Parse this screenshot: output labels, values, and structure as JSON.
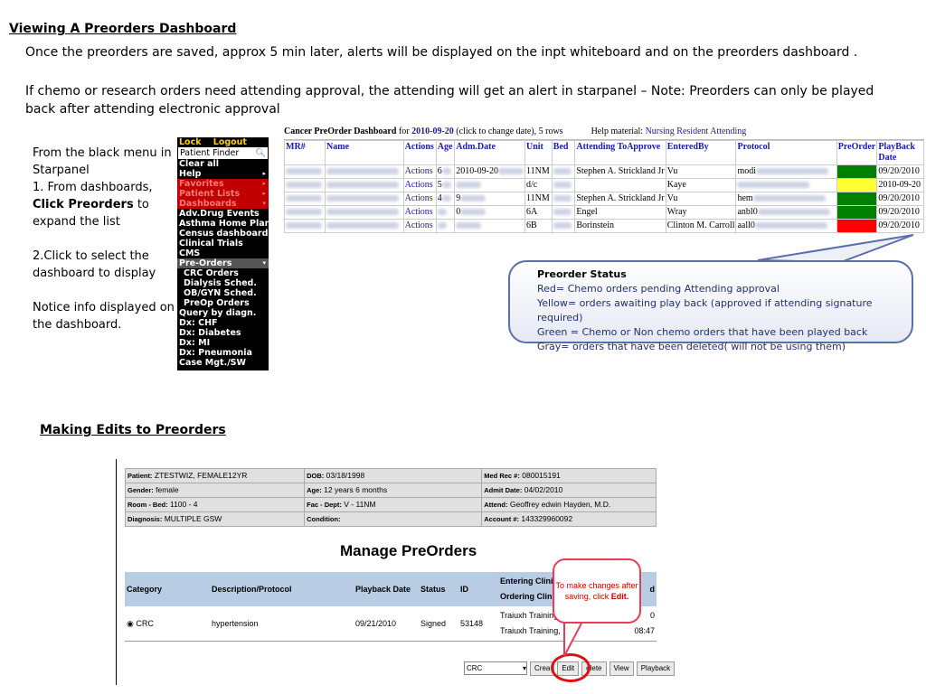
{
  "title": "Viewing  A Preorders Dashboard",
  "para1": "Once the preorders are saved, approx 5 min later, alerts will be displayed on the inpt whiteboard and on the preorders dashboard .",
  "para2": " If chemo or  research orders need attending approval,  the attending will get an alert in starpanel – Note:  Preorders can only be played back after attending electronic approval",
  "side": {
    "l1": "From the black menu in Starpanel",
    "l2a": "1. From dashboards, ",
    "l2b": "Click Preorders",
    "l2c": "  to expand the list",
    "l3": "2.Click  to select the dashboard to display",
    "l4": "Notice info displayed on the dashboard."
  },
  "menu": {
    "lock": "Lock",
    "logout": "Logout",
    "finder": "Patient Finder",
    "search_icon": "search-icon",
    "items": [
      {
        "label": "Clear all",
        "style": "plain",
        "arrow": ""
      },
      {
        "label": "Help",
        "style": "plain",
        "arrow": "▸"
      },
      {
        "label": "Favorites",
        "style": "red",
        "arrow": "▸"
      },
      {
        "label": "Patient Lists",
        "style": "red",
        "arrow": "▸"
      },
      {
        "label": "Dashboards",
        "style": "red",
        "arrow": "▾"
      },
      {
        "label": "Adv.Drug Events",
        "style": "plain",
        "arrow": ""
      },
      {
        "label": "Asthma Home Plan",
        "style": "plain",
        "arrow": ""
      },
      {
        "label": "Census dashboard",
        "style": "plain",
        "arrow": ""
      },
      {
        "label": "Clinical Trials",
        "style": "plain",
        "arrow": ""
      },
      {
        "label": "CMS",
        "style": "plain",
        "arrow": ""
      },
      {
        "label": "Pre-Orders",
        "style": "gray",
        "arrow": "▾"
      },
      {
        "label": "CRC Orders",
        "style": "sub",
        "arrow": ""
      },
      {
        "label": "Dialysis Sched.",
        "style": "sub",
        "arrow": ""
      },
      {
        "label": "OB/GYN Sched.",
        "style": "sub",
        "arrow": ""
      },
      {
        "label": "PreOp Orders",
        "style": "sub",
        "arrow": ""
      },
      {
        "label": "Query by diagn.",
        "style": "plain",
        "arrow": ""
      },
      {
        "label": "Dx: CHF",
        "style": "plain",
        "arrow": ""
      },
      {
        "label": "Dx: Diabetes",
        "style": "plain",
        "arrow": ""
      },
      {
        "label": "Dx: MI",
        "style": "plain",
        "arrow": ""
      },
      {
        "label": "Dx: Pneumonia",
        "style": "plain",
        "arrow": ""
      },
      {
        "label": "Case Mgt./SW",
        "style": "plain",
        "arrow": ""
      }
    ]
  },
  "dashboard": {
    "title": "Cancer PreOrder Dashboard",
    "for": " for ",
    "date": "2010-09-20",
    "note": " (click to change date), 5 rows",
    "help": "Help material:",
    "help_links": [
      "Nursing",
      "Resident",
      "Attending"
    ],
    "headers": [
      "MR#",
      "Name",
      "Actions",
      "Age",
      "Adm.Date",
      "Unit",
      "Bed",
      "Attending ToApprove",
      "EnteredBy",
      "Protocol",
      "PreOrder",
      "PlayBack Date"
    ],
    "rows": [
      {
        "actions": "Actions",
        "age": "6",
        "adm": "2010-09-20",
        "unit": "11NM",
        "attending": "Stephen A. Strickland Jr",
        "entered": "Vu",
        "protocol": "modi",
        "color": "#008000",
        "playback": "09/20/2010"
      },
      {
        "actions": "Actions",
        "age": "5",
        "adm": "",
        "unit": "d/c",
        "attending": "",
        "entered": "Kaye",
        "protocol": "",
        "color": "#ffff33",
        "playback": "2010-09-20"
      },
      {
        "actions": "Actions",
        "age": "4",
        "adm": "9",
        "unit": "11NM",
        "attending": "Stephen A. Strickland Jr",
        "entered": "Vu",
        "protocol": "hem",
        "color": "#008000",
        "playback": "09/20/2010"
      },
      {
        "actions": "Actions",
        "age": "",
        "adm": "0",
        "unit": "6A",
        "attending": "Engel",
        "entered": "Wray",
        "protocol": "anbl0",
        "color": "#008000",
        "playback": "09/20/2010"
      },
      {
        "actions": "Actions",
        "age": "",
        "adm": "",
        "unit": "6B",
        "attending": "Borinstein",
        "entered": "Clinton M. Carroll",
        "protocol": "aall0",
        "color": "#ff0000",
        "playback": "09/20/2010"
      }
    ]
  },
  "callout": {
    "title": "Preorder Status",
    "lines": [
      "Red= Chemo orders pending Attending approval",
      "Yellow= orders awaiting play back (approved if attending  signature required)",
      "Green = Chemo or Non chemo orders that have been played back",
      "Gray= orders that have been deleted( will not be using them)"
    ]
  },
  "section2_title": "Making Edits to  Preorders",
  "patient": {
    "c1": [
      [
        "Patient:",
        "ZTESTWIZ, FEMALE12YR"
      ],
      [
        "Gender:",
        "female"
      ],
      [
        "Room - Bed:",
        "1100 - 4"
      ],
      [
        "Diagnosis:",
        "MULTIPLE GSW"
      ]
    ],
    "c2": [
      [
        "DOB:",
        "03/18/1998"
      ],
      [
        "Age:",
        "12 years 6 months"
      ],
      [
        "Fac - Dept:",
        "V - 11NM"
      ],
      [
        "Condition:",
        ""
      ]
    ],
    "c3": [
      [
        "Med Rec #:",
        "080015191"
      ],
      [
        "Admit Date:",
        "04/02/2010"
      ],
      [
        "Attend:",
        "Geoffrey edwin Hayden, M.D."
      ],
      [
        "Account #:",
        "143329960092"
      ]
    ]
  },
  "manage": {
    "title": "Manage PreOrders",
    "headers": [
      "Category",
      "Description/Protocol",
      "Playback Date",
      "Status",
      "ID",
      "Entering Clinician",
      "Ordering Clinician",
      "d"
    ],
    "row": {
      "category": "CRC",
      "desc": "hypertension",
      "playback": "09/21/2010",
      "status": "Signed",
      "id": "53148",
      "entering": "Traiuxh Training, MD",
      "ordering": "Traiuxh Training, MD",
      "time_a": "0",
      "time_b": "08:47"
    },
    "select_value": "CRC",
    "buttons": [
      "Crea",
      "Edit",
      "elete",
      "View",
      "Playback"
    ],
    "bubble_a": "To make changes after saving, click ",
    "bubble_b": "Edit."
  }
}
